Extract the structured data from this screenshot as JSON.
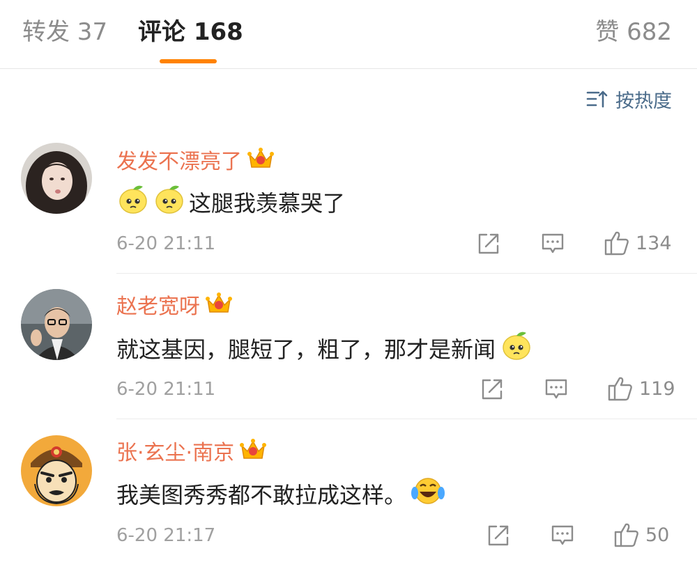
{
  "tabs": {
    "repost": "转发 37",
    "comments": "评论 168",
    "likes": "赞 682"
  },
  "sort_label": "按热度",
  "colors": {
    "accent": "#ff8200",
    "username": "#eb7350",
    "sort": "#4a6b8a"
  },
  "comments": [
    {
      "username": "发发不漂亮了",
      "emoji": [
        "lemon-emoji",
        "lemon-emoji"
      ],
      "text": "这腿我羡慕哭了",
      "time": "6-20 21:11",
      "likes": "134"
    },
    {
      "username": "赵老宽呀",
      "text": "就这基因，腿短了，粗了，那才是新闻",
      "emoji_after": "lemon-emoji",
      "time": "6-20 21:11",
      "likes": "119"
    },
    {
      "username": "张·玄尘·南京",
      "text": "我美图秀秀都不敢拉成这样。",
      "emoji_after": "laugh-cry-emoji",
      "time": "6-20 21:17",
      "likes": "50"
    }
  ]
}
